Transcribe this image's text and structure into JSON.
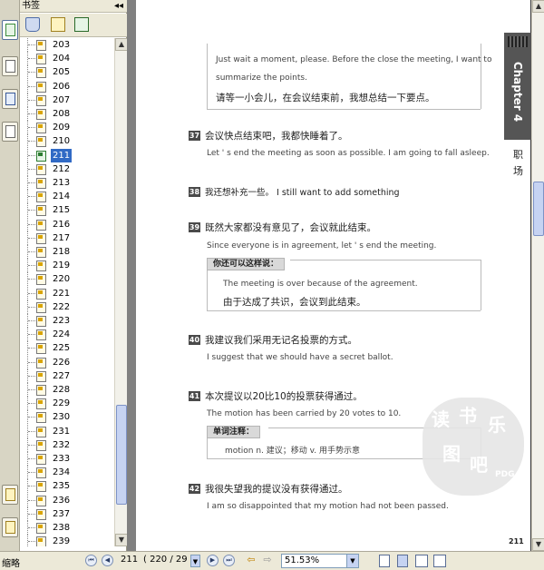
{
  "window": {
    "panel_title": "书签",
    "collapse_glyph": "◂◂"
  },
  "left_tools": [
    "pages-icon",
    "bookmarks-icon",
    "signatures-icon",
    "layers-icon",
    "attachments-icon",
    "comments-icon"
  ],
  "bookmarks": {
    "items": [
      "203",
      "204",
      "205",
      "206",
      "207",
      "208",
      "209",
      "210",
      "211",
      "212",
      "213",
      "214",
      "215",
      "216",
      "217",
      "218",
      "219",
      "220",
      "221",
      "222",
      "223",
      "224",
      "225",
      "226",
      "227",
      "228",
      "229",
      "230",
      "231",
      "232",
      "233",
      "234",
      "235",
      "236",
      "237",
      "238",
      "239"
    ],
    "selected": "211"
  },
  "page": {
    "intro_en_1": "Just wait a moment, please. Before the close the meeting, I want to",
    "intro_en_2": "summarize the points.",
    "intro_cn": "请等一小会儿，在会议结束前，我想总结一下要点。",
    "item37_num": "37",
    "item37_cn": "会议快点结束吧，我都快睡着了。",
    "item37_en": "Let ' s end the meeting as soon as possible. I am going to fall asleep.",
    "item38_num": "38",
    "item38_text": "我还想补充一些。 I still want to add something",
    "item39_num": "39",
    "item39_cn": "既然大家都没有意见了，会议就此结束。",
    "item39_en": "Since everyone is in agreement, let ' s end the meeting.",
    "alt_tag": "你还可以这样说：",
    "alt_en": "The meeting is over because of the agreement.",
    "alt_cn": "由于达成了共识，会议到此结束。",
    "item40_num": "40",
    "item40_cn": "我建议我们采用无记名投票的方式。",
    "item40_en": "I suggest that we should have a secret ballot.",
    "item41_num": "41",
    "item41_cn": "本次提议以20比10的投票获得通过。",
    "item41_en": "The motion has been carried by 20 votes to 10.",
    "vocab_tag": "单词注释：",
    "vocab_line": "motion   n. 建议；移动   v. 用手势示意",
    "item42_num": "42",
    "item42_cn": "我很失望我的提议没有获得通过。",
    "item42_en": "I am so disappointed that my motion had not been passed.",
    "chapter": "Chapter 4",
    "side_1": "职",
    "side_2": "场",
    "seal_chars": [
      "读",
      "书",
      "乐",
      "图",
      "吧"
    ],
    "seal_mark": "PDG",
    "page_number": "211"
  },
  "status": {
    "label": "缩略",
    "page_current": "211",
    "page_total": "( 220 / 29",
    "zoom": "51.53%"
  }
}
